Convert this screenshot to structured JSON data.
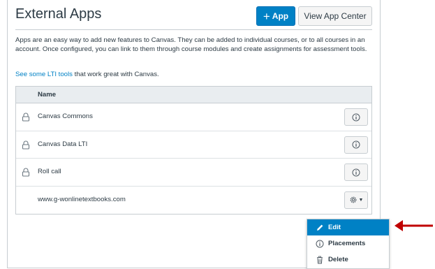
{
  "header": {
    "title": "External Apps",
    "add_app_label": "App",
    "view_center_label": "View App Center"
  },
  "intro": {
    "description": "Apps are an easy way to add new features to Canvas. They can be added to individual courses, or to all courses in an account. Once configured, you can link to them through course modules and create assignments for assessment tools.",
    "lti_link": "See some LTI tools",
    "lti_suffix": " that work great with Canvas."
  },
  "table": {
    "column_name": "Name",
    "rows": [
      {
        "name": "Canvas Commons",
        "locked": true
      },
      {
        "name": "Canvas Data LTI",
        "locked": true
      },
      {
        "name": "Roll call",
        "locked": true
      },
      {
        "name": "www.g-wonlinetextbooks.com",
        "locked": false
      }
    ]
  },
  "menu": {
    "items": [
      {
        "label": "Edit",
        "icon": "pencil-icon",
        "active": true
      },
      {
        "label": "Placements",
        "icon": "info-icon",
        "active": false
      },
      {
        "label": "Delete",
        "icon": "trash-icon",
        "active": false
      }
    ]
  },
  "colors": {
    "accent": "#0081c5",
    "arrow": "#c00000",
    "header_bg": "#e9edf0"
  }
}
